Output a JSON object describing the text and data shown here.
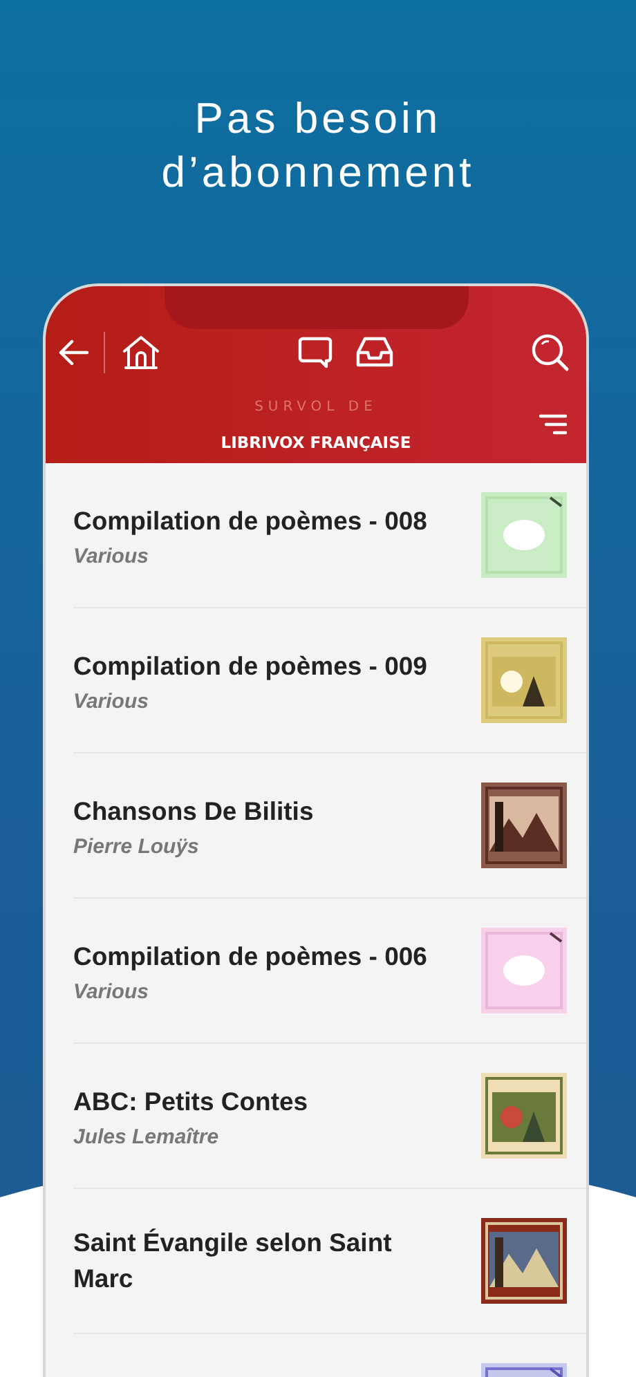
{
  "headline": "Pas besoin\nd’abonnement",
  "header": {
    "subtitle": "SURVOL DE",
    "title": "LIBRIVOX FRANÇAISE"
  },
  "books": [
    {
      "title": "Compilation de poèmes - 008",
      "author": "Various",
      "cover": {
        "kind": "picture"
      }
    },
    {
      "title": "Compilation de poèmes - 009",
      "author": "Various",
      "cover": {
        "kind": "picture"
      }
    },
    {
      "title": "Chansons De Bilitis",
      "author": "Pierre Louÿs",
      "cover": {
        "kind": "picture"
      }
    },
    {
      "title": "Compilation de poèmes - 006",
      "author": "Various",
      "cover": {
        "kind": "picture"
      }
    },
    {
      "title": "ABC: Petits Contes",
      "author": "Jules Lemaître",
      "cover": {
        "kind": "picture"
      }
    },
    {
      "title": "Saint Évangile selon Saint Marc",
      "cover": {
        "kind": "picture"
      }
    },
    {
      "cover": {
        "kind": "picture"
      }
    }
  ]
}
